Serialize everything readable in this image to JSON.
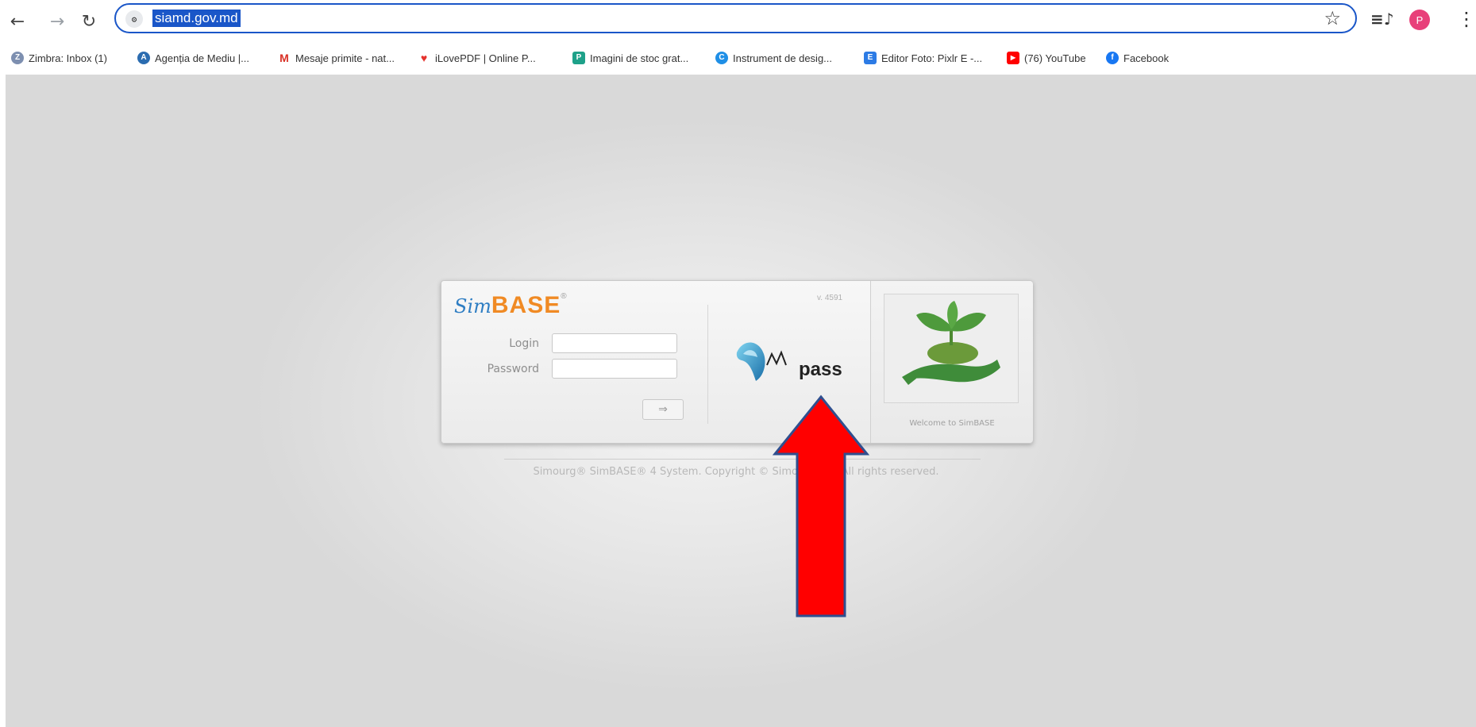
{
  "browser": {
    "url": "siamd.gov.md",
    "avatar_initial": "P",
    "bookmarks": [
      {
        "label": "Zimbra: Inbox (1)",
        "icon": "zimbra-icon",
        "color": "#7d8fb0"
      },
      {
        "label": "Agenția de Mediu |...",
        "icon": "agentia-icon",
        "color": "#2b6cb0"
      },
      {
        "label": "Mesaje primite - nat...",
        "icon": "gmail-icon",
        "color": "#d93025"
      },
      {
        "label": "iLovePDF | Online P...",
        "icon": "ilovepdf-icon",
        "color": "#e5322d"
      },
      {
        "label": "Imagini de stoc grat...",
        "icon": "stock-images-icon",
        "color": "#1ea189"
      },
      {
        "label": "Instrument de desig...",
        "icon": "canva-icon",
        "color": "#1f8fe6"
      },
      {
        "label": "Editor Foto: Pixlr E -...",
        "icon": "pixlr-icon",
        "color": "#2c7be5"
      },
      {
        "label": "(76) YouTube",
        "icon": "youtube-icon",
        "color": "#ff0000"
      },
      {
        "label": "Facebook",
        "icon": "facebook-icon",
        "color": "#1877f2"
      }
    ]
  },
  "login": {
    "logo_sim": "Sim",
    "logo_base": "BASE",
    "logo_reg": "®",
    "version": "v. 4591",
    "login_label": "Login",
    "password_label": "Password",
    "submit_arrow": "⇒",
    "mpass_label": "pass",
    "welcome": "Welcome to SimBASE"
  },
  "footer": {
    "copyright": "Simourg® SimBASE® 4 System. Copyright © Simourg Ltd. All rights reserved."
  },
  "annotation": {
    "arrow_color": "#ff0000",
    "arrow_stroke": "#2f4f8f"
  }
}
